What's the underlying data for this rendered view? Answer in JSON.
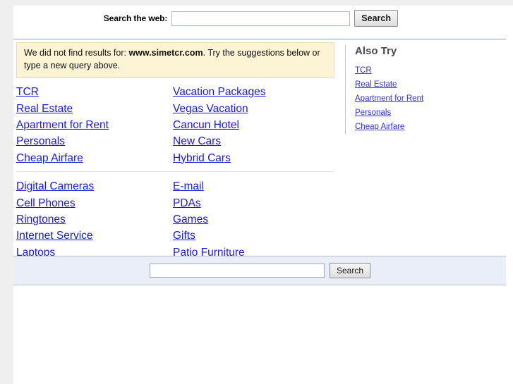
{
  "top_search": {
    "label": "Search the web:",
    "input_value": "",
    "input_placeholder": "",
    "button_label": "Search"
  },
  "notice": {
    "prefix": "We did not find results for: ",
    "query": "www.simetcr.com",
    "suffix": ". Try the suggestions below or type a new query above."
  },
  "suggestions": {
    "group1": [
      {
        "label": "TCR"
      },
      {
        "label": "Vacation Packages"
      },
      {
        "label": "Real Estate"
      },
      {
        "label": "Vegas Vacation"
      },
      {
        "label": "Apartment for Rent"
      },
      {
        "label": "Cancun Hotel"
      },
      {
        "label": "Personals"
      },
      {
        "label": "New Cars"
      },
      {
        "label": "Cheap Airfare"
      },
      {
        "label": "Hybrid Cars"
      }
    ],
    "group2": [
      {
        "label": "Digital Cameras"
      },
      {
        "label": "E-mail"
      },
      {
        "label": "Cell Phones"
      },
      {
        "label": "PDAs"
      },
      {
        "label": "Ringtones"
      },
      {
        "label": "Games"
      },
      {
        "label": "Internet Service"
      },
      {
        "label": "Gifts"
      },
      {
        "label": "Laptops"
      },
      {
        "label": "Patio Furniture"
      }
    ]
  },
  "also_try": {
    "title": "Also Try",
    "items": [
      {
        "label": "TCR"
      },
      {
        "label": "Real Estate"
      },
      {
        "label": "Apartment for Rent"
      },
      {
        "label": "Personals"
      },
      {
        "label": "Cheap Airfare"
      }
    ]
  },
  "footer_search": {
    "input_value": "",
    "input_placeholder": "",
    "button_label": "Search"
  },
  "colors": {
    "link": "#1a1ae0",
    "sidebar_link": "#3333cc",
    "notice_bg": "#fcf4d5",
    "notice_border": "#e7dcaf",
    "rule": "#8ba5c4",
    "footer_bg": "#eaeef8",
    "page_bg": "#ffffff",
    "canvas_bg": "#efefef"
  }
}
